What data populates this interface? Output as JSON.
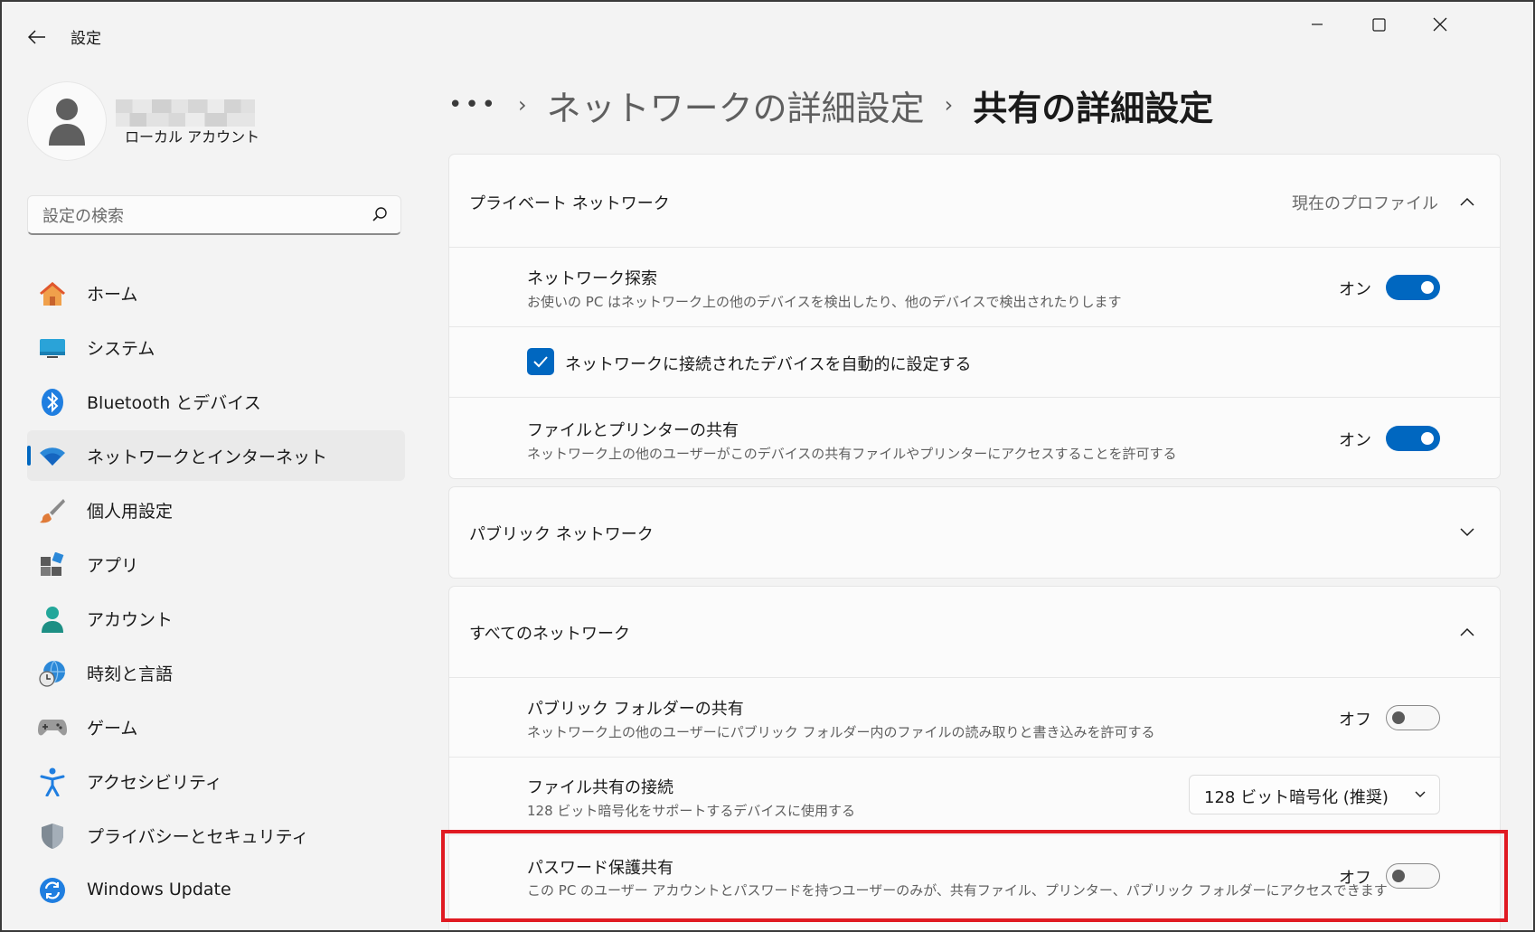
{
  "app": {
    "title": "設定"
  },
  "window_controls": {
    "minimize": "minimize-icon",
    "maximize": "maximize-icon",
    "close": "close-icon"
  },
  "user": {
    "account_type": "ローカル アカウント"
  },
  "search": {
    "placeholder": "設定の検索"
  },
  "sidebar": {
    "items": [
      {
        "label": "ホーム",
        "icon": "home-icon"
      },
      {
        "label": "システム",
        "icon": "system-icon"
      },
      {
        "label": "Bluetooth とデバイス",
        "icon": "bluetooth-icon"
      },
      {
        "label": "ネットワークとインターネット",
        "icon": "wifi-icon",
        "selected": true
      },
      {
        "label": "個人用設定",
        "icon": "brush-icon"
      },
      {
        "label": "アプリ",
        "icon": "apps-icon"
      },
      {
        "label": "アカウント",
        "icon": "account-icon"
      },
      {
        "label": "時刻と言語",
        "icon": "time-language-icon"
      },
      {
        "label": "ゲーム",
        "icon": "gamepad-icon"
      },
      {
        "label": "アクセシビリティ",
        "icon": "accessibility-icon"
      },
      {
        "label": "プライバシーとセキュリティ",
        "icon": "shield-icon"
      },
      {
        "label": "Windows Update",
        "icon": "update-icon"
      }
    ]
  },
  "breadcrumb": {
    "more": "•••",
    "parent": "ネットワークの詳細設定",
    "current": "共有の詳細設定"
  },
  "private_network": {
    "title": "プライベート ネットワーク",
    "meta": "現在のプロファイル",
    "discovery": {
      "title": "ネットワーク探索",
      "desc": "お使いの PC はネットワーク上の他のデバイスを検出したり、他のデバイスで検出されたりします",
      "state": "オン"
    },
    "auto_setup": {
      "label": "ネットワークに接続されたデバイスを自動的に設定する",
      "checked": true
    },
    "file_printer": {
      "title": "ファイルとプリンターの共有",
      "desc": "ネットワーク上の他のユーザーがこのデバイスの共有ファイルやプリンターにアクセスすることを許可する",
      "state": "オン"
    }
  },
  "public_network": {
    "title": "パブリック ネットワーク"
  },
  "all_networks": {
    "title": "すべてのネットワーク",
    "public_folder": {
      "title": "パブリック フォルダーの共有",
      "desc": "ネットワーク上の他のユーザーにパブリック フォルダー内のファイルの読み取りと書き込みを許可する",
      "state": "オフ"
    },
    "file_sharing_conn": {
      "title": "ファイル共有の接続",
      "desc": "128 ビット暗号化をサポートするデバイスに使用する",
      "value": "128 ビット暗号化 (推奨)"
    },
    "password_sharing": {
      "title": "パスワード保護共有",
      "desc": "この PC のユーザー アカウントとパスワードを持つユーザーのみが、共有ファイル、プリンター、パブリック フォルダーにアクセスできます",
      "state": "オフ"
    }
  },
  "colors": {
    "accent": "#0067c0",
    "highlight": "#e01a22"
  }
}
